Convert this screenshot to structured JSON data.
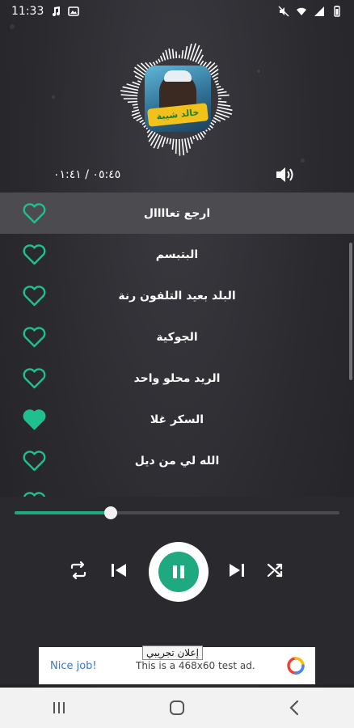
{
  "status_bar": {
    "time": "11:33",
    "icons": [
      "music-note-icon",
      "gallery-icon",
      "mute-icon",
      "wifi-icon",
      "signal-icon",
      "battery-icon"
    ]
  },
  "player_header": {
    "album_art_text": "خالد شيبة",
    "time_display": "٠٥:٤٥ / ٠١:٤١"
  },
  "playlist": {
    "tracks": [
      {
        "title": "ارجع تعاااال",
        "favorite": false,
        "active": true
      },
      {
        "title": "البتبسم",
        "favorite": false,
        "active": false
      },
      {
        "title": "البلد بعيد التلفون رنة",
        "favorite": false,
        "active": false
      },
      {
        "title": "الجوكية",
        "favorite": false,
        "active": false
      },
      {
        "title": "الريد محلو واحد",
        "favorite": false,
        "active": false
      },
      {
        "title": "السكر غلا",
        "favorite": true,
        "active": false
      },
      {
        "title": "الله لي من ديل",
        "favorite": false,
        "active": false
      }
    ]
  },
  "player": {
    "progress_fraction": 0.295,
    "controls": [
      "repeat-icon",
      "previous-icon",
      "pause-icon",
      "next-icon",
      "shuffle-icon"
    ]
  },
  "ad": {
    "tag": "إعلان تجريبي",
    "nice_job": "Nice job!",
    "text": "This is a 468x60 test ad."
  },
  "colors": {
    "accent": "#1fa980",
    "heart": "#1fbf8f",
    "background": "#2b2b30"
  }
}
